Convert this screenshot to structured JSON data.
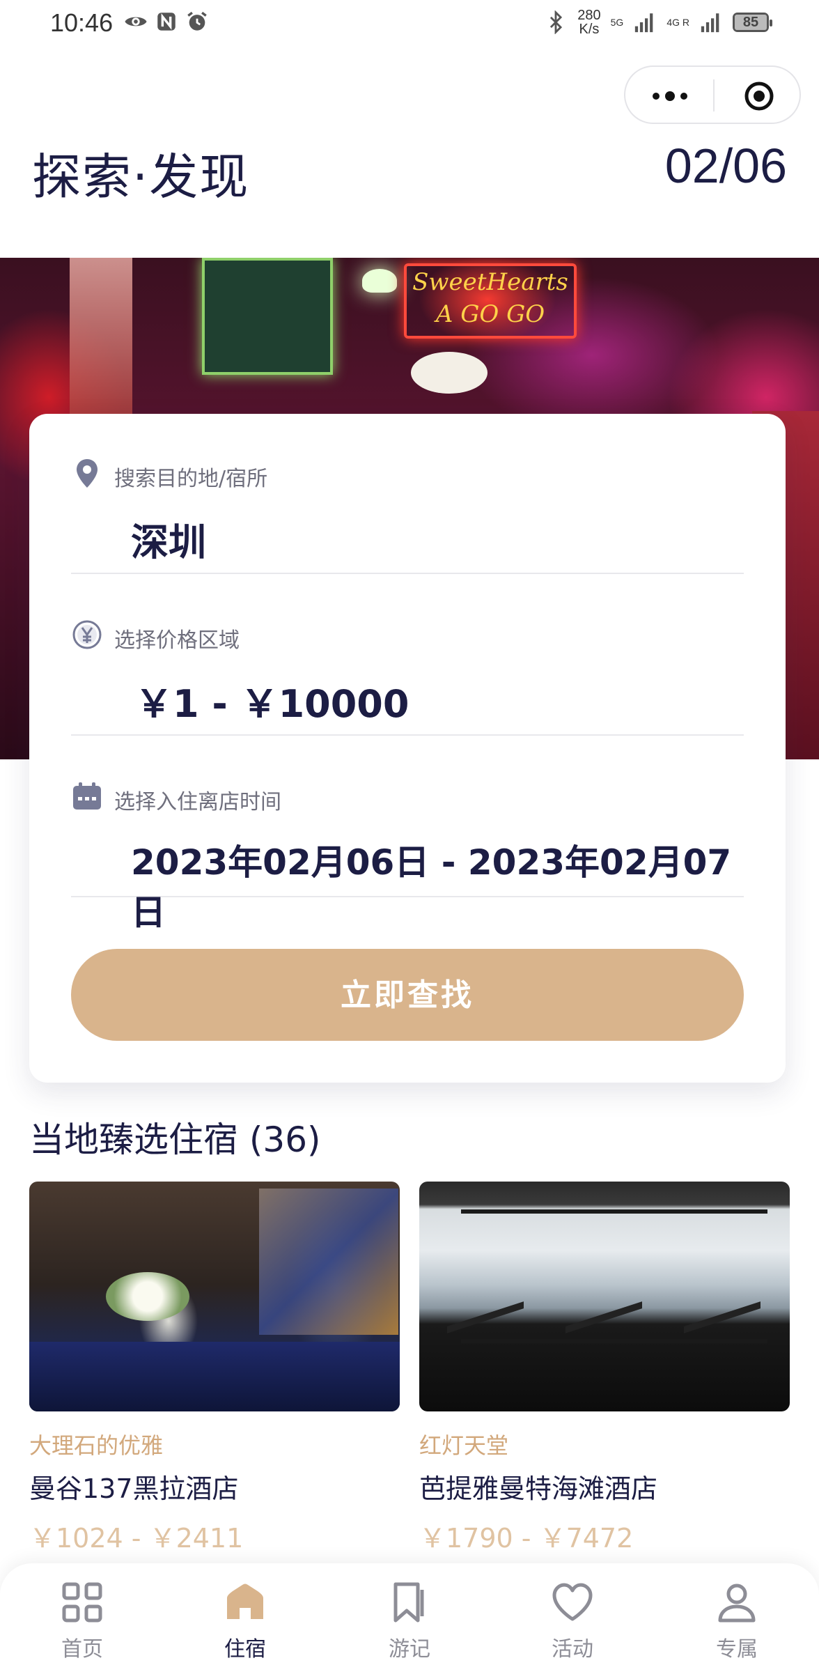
{
  "status_bar": {
    "time": "10:46",
    "speed_value": "280",
    "speed_unit": "K/s",
    "net1": "5G",
    "net2": "4G R",
    "battery": "85"
  },
  "header": {
    "title": "探索·发现",
    "date": "02/06"
  },
  "search": {
    "destination_label": "搜索目的地/宿所",
    "destination_value": "深圳",
    "price_label": "选择价格区域",
    "price_value": "￥1 - ￥10000",
    "date_label": "选择入住离店时间",
    "date_value": "2023年02月06日 - 2023年02月07日",
    "button_label": "立即查找"
  },
  "hero": {
    "neon_sign": "SweetHearts A GO GO"
  },
  "recommend": {
    "title": "当地臻选住宿 (36)",
    "hotels": [
      {
        "tag": "大理石的优雅",
        "name": "曼谷137黑拉酒店",
        "price": "￥1024 - ￥2411"
      },
      {
        "tag": "红灯天堂",
        "name": "芭提雅曼特海滩酒店",
        "price": "￥1790 - ￥7472"
      }
    ]
  },
  "tabbar": {
    "items": [
      {
        "label": "首页",
        "icon": "grid-icon"
      },
      {
        "label": "住宿",
        "icon": "house-icon"
      },
      {
        "label": "游记",
        "icon": "bookmark-icon"
      },
      {
        "label": "活动",
        "icon": "heart-icon"
      },
      {
        "label": "专属",
        "icon": "user-icon"
      }
    ],
    "active": "住宿"
  },
  "colors": {
    "primary_text": "#1c1d44",
    "accent": "#d9b48c",
    "tag": "#d2a87c",
    "price": "#e0c3a2",
    "muted": "#8d8d96"
  }
}
